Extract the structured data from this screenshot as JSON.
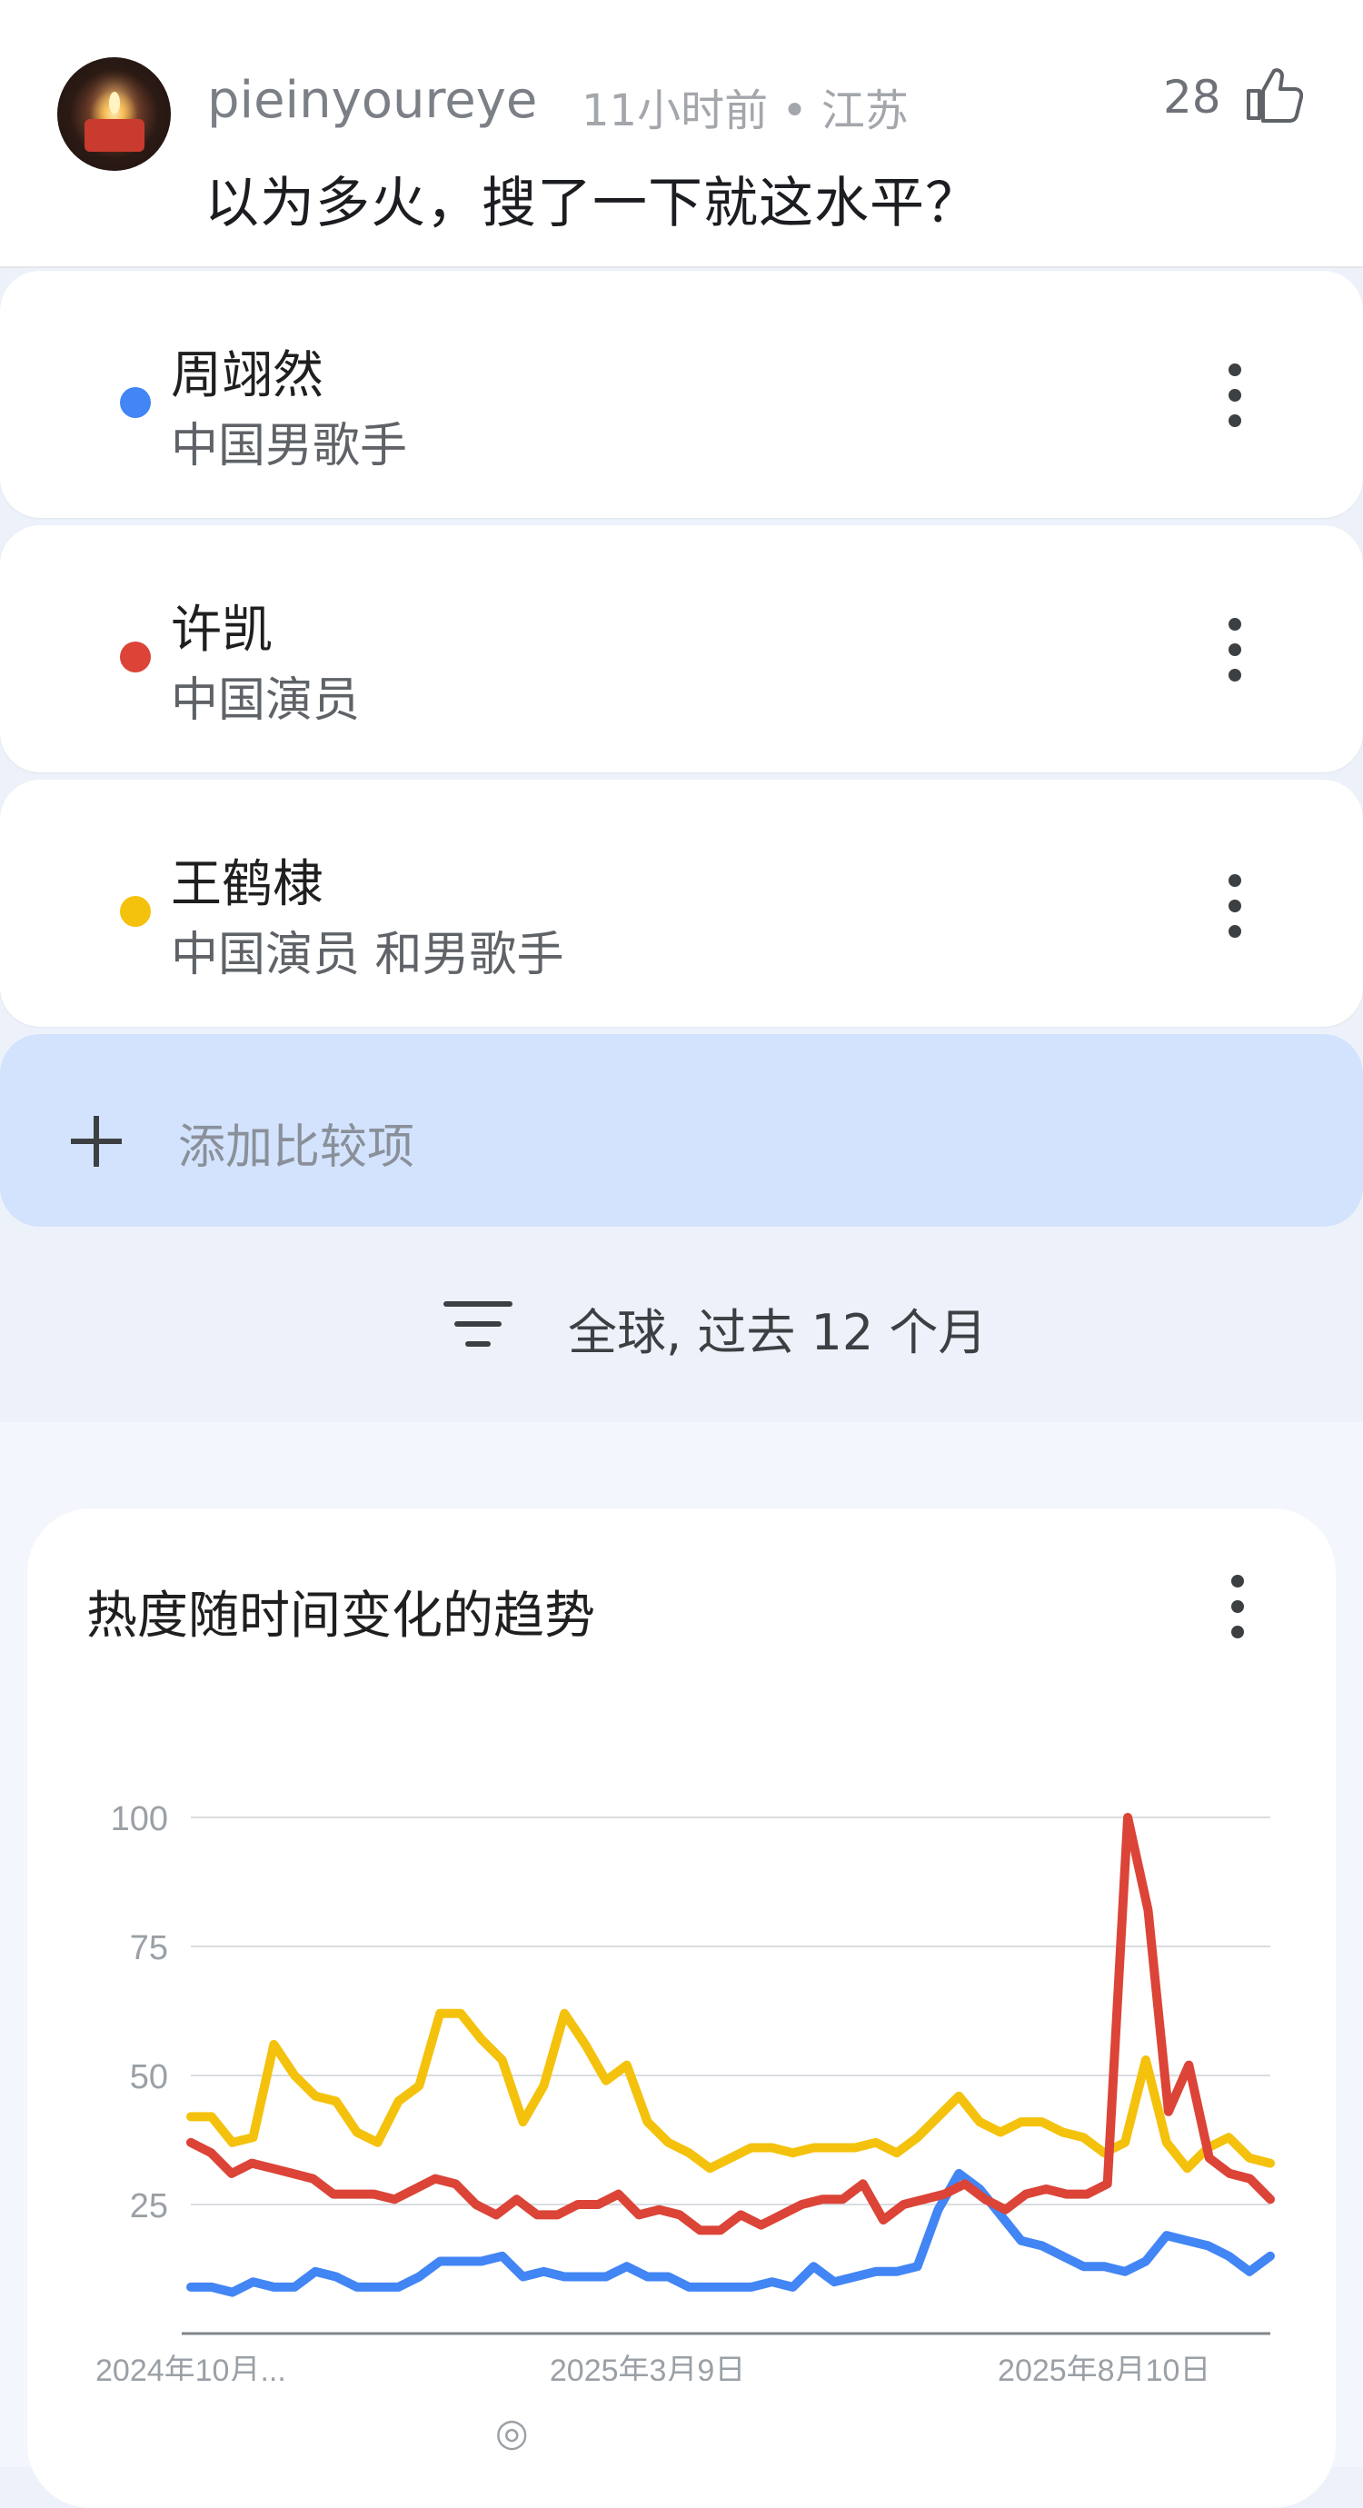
{
  "comment": {
    "username": "pieinyoureye",
    "meta": "11小时前 • 江苏",
    "likes": "28",
    "text": "以为多火，搜了一下就这水平？"
  },
  "terms": [
    {
      "name": "周翊然",
      "desc": "中国男歌手",
      "color": "#4285f4"
    },
    {
      "name": "许凯",
      "desc": "中国演员",
      "color": "#db4437"
    },
    {
      "name": "王鹤棣",
      "desc": "中国演员 和男歌手",
      "color": "#f4c20d"
    }
  ],
  "add_compare": {
    "label": "添加比较项"
  },
  "filter": {
    "label": "全球, 过去 12 个月"
  },
  "chart": {
    "title": "热度随时间变化的趋势"
  },
  "chart_data": {
    "type": "line",
    "title": "热度随时间变化的趋势",
    "ylim": [
      0,
      100
    ],
    "yticks": [
      25,
      50,
      75,
      100
    ],
    "x_tick_labels": [
      "2024年10月...",
      "2025年3月9日",
      "2025年8月10日"
    ],
    "x_tick_index": [
      0,
      22,
      44
    ],
    "grid": true,
    "series": [
      {
        "name": "周翊然",
        "color": "#4285f4",
        "values": [
          9,
          9,
          8,
          10,
          9,
          9,
          12,
          11,
          9,
          9,
          9,
          11,
          14,
          14,
          14,
          15,
          11,
          12,
          11,
          11,
          11,
          13,
          11,
          11,
          9,
          9,
          9,
          9,
          10,
          9,
          13,
          10,
          11,
          12,
          12,
          13,
          24,
          31,
          28,
          23,
          18,
          17,
          15,
          13,
          13,
          12,
          14,
          19,
          18,
          17,
          15,
          12,
          15
        ]
      },
      {
        "name": "许凯",
        "color": "#db4437",
        "values": [
          37,
          35,
          31,
          33,
          32,
          31,
          30,
          27,
          27,
          27,
          26,
          28,
          30,
          29,
          25,
          23,
          26,
          23,
          23,
          25,
          25,
          27,
          23,
          24,
          23,
          20,
          20,
          23,
          21,
          23,
          25,
          26,
          26,
          29,
          22,
          25,
          26,
          27,
          29,
          26,
          24,
          27,
          28,
          27,
          27,
          29,
          100,
          82,
          43,
          52,
          34,
          31,
          30,
          26
        ]
      },
      {
        "name": "王鹤棣",
        "color": "#f4c20d",
        "values": [
          42,
          42,
          37,
          38,
          56,
          50,
          46,
          45,
          39,
          37,
          45,
          48,
          62,
          62,
          57,
          53,
          41,
          48,
          62,
          56,
          49,
          52,
          41,
          37,
          35,
          32,
          34,
          36,
          36,
          35,
          36,
          36,
          36,
          37,
          35,
          38,
          42,
          46,
          41,
          39,
          41,
          41,
          39,
          38,
          35,
          37,
          53,
          37,
          32,
          36,
          38,
          34,
          33
        ]
      }
    ]
  }
}
